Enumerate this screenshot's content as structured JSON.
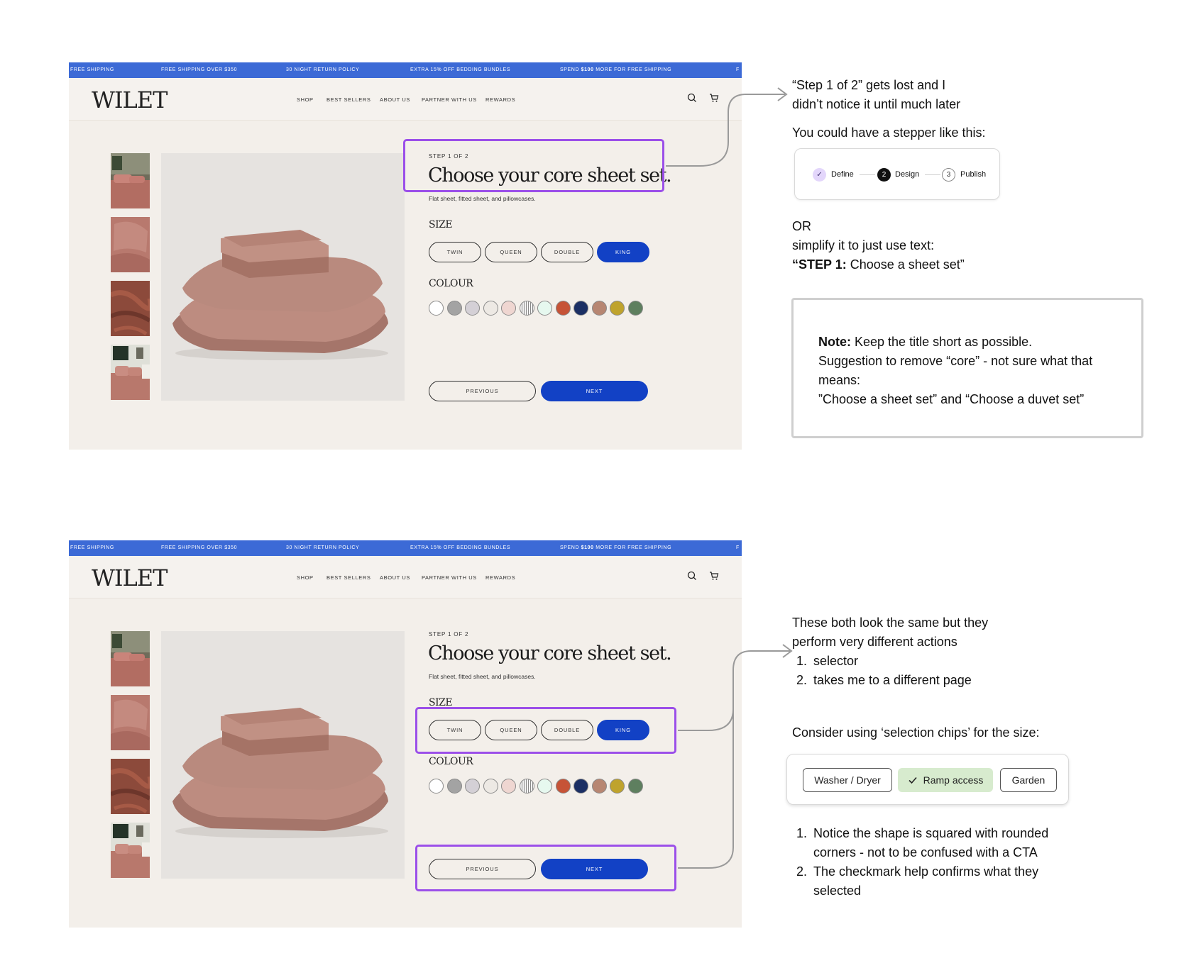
{
  "promo": {
    "items": [
      "FREE SHIPPING",
      "FREE SHIPPING OVER $350",
      "30 NIGHT RETURN POLICY",
      "EXTRA 15% OFF BEDDING BUNDLES"
    ],
    "spend_prefix": "SPEND ",
    "spend_amount": "$100",
    "spend_suffix": " MORE FOR FREE SHIPPING",
    "cut": "F"
  },
  "header": {
    "logo": "WILET",
    "nav": [
      "SHOP",
      "BEST SELLERS",
      "ABOUT US",
      "PARTNER WITH US",
      "REWARDS"
    ]
  },
  "product": {
    "step": "STEP 1 OF 2",
    "title": "Choose your core sheet set.",
    "subtitle": "Flat sheet, fitted sheet, and pillowcases.",
    "size_label": "SIZE",
    "sizes": [
      "TWIN",
      "QUEEN",
      "DOUBLE",
      "KING"
    ],
    "selected_size": "KING",
    "colour_label": "COLOUR",
    "colours": [
      "#ffffff",
      "#a3a3a3",
      "#d4d0d6",
      "#ede9e4",
      "#efd6d1",
      "striped",
      "#e6f8ef",
      "#c65337",
      "#1b2f64",
      "#b78672",
      "#bfa32d",
      "#5e7f5f"
    ],
    "previous": "PREVIOUS",
    "next": "NEXT"
  },
  "notes1": {
    "line1": "“Step 1 of 2” gets lost and I",
    "line2": "didn’t notice it until much later",
    "stepper_intro": "You could have a stepper like this:",
    "stepper": [
      {
        "num": "✓",
        "label": "Define"
      },
      {
        "num": "2",
        "label": "Design"
      },
      {
        "num": "3",
        "label": "Publish"
      }
    ],
    "or": "OR",
    "simplify": "simplify it to just use text:",
    "step_bold": "“STEP 1:",
    "step_rest": " Choose a sheet set”"
  },
  "notebox": {
    "bold": "Note:",
    "line1_rest": " Keep the title short as possible.",
    "line2": "Suggestion to remove “core” - not sure what that",
    "line3": "means:",
    "line4": "”Choose a sheet set” and “Choose a duvet set”"
  },
  "notes2": {
    "line1": "These both look the same but they",
    "line2": "perform very different actions",
    "list": [
      "selector",
      "takes me to a different page"
    ],
    "chips_intro": "Consider using ‘selection chips’ for the size:",
    "chips": [
      "Washer / Dryer",
      "Ramp access",
      "Garden"
    ],
    "list2": [
      "Notice the shape is squared with rounded",
      "corners - not to be confused with a CTA",
      "The checkmark help confirms what they",
      "selected"
    ]
  }
}
